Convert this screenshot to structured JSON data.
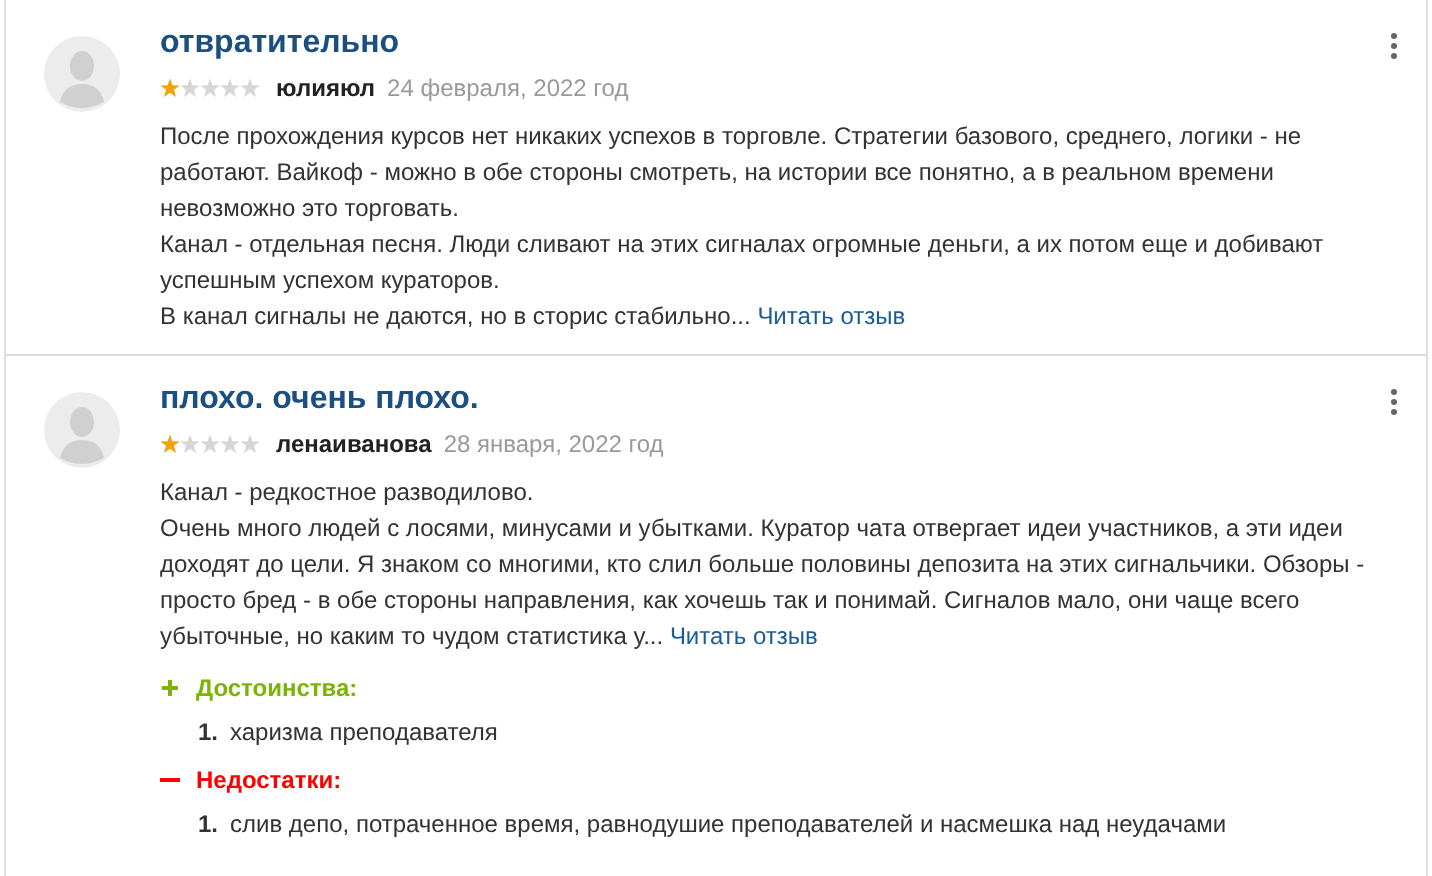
{
  "reviews": [
    {
      "title": "отвратительно",
      "stars": 1,
      "author": "юлияюл",
      "date": "24 февраля, 2022 год",
      "paragraphs": [
        "После прохождения курсов нет никаких успехов в торговле. Стратегии базового, среднего, логики - не работают. Вайкоф - можно в обе стороны смотреть, на истории все понятно, а в реальном времени невозможно это торговать.",
        "Канал - отдельная песня. Люди сливают на этих сигналах огромные деньги, а их потом еще и добивают успешным успехом кураторов.",
        "В канал сигналы не даются, но в сторис стабильно..."
      ],
      "read_more": "Читать отзыв"
    },
    {
      "title": "плохо. очень плохо.",
      "stars": 1,
      "author": "ленаиванова",
      "date": "28 января, 2022 год",
      "paragraphs": [
        "Канал - редкостное разводилово.",
        "Очень много людей с лосями, минусами и убытками. Куратор чата отвергает идеи участников, а эти идеи доходят до цели. Я знаком со многими, кто слил больше половины депозита на этих сигнальчики. Обзоры - просто бред - в обе стороны направления, как хочешь так и понимай. Сигналов мало, они чаще всего убыточные, но каким то чудом статистика у..."
      ],
      "read_more": "Читать отзыв",
      "sections": [
        {
          "kind": "pros",
          "heading": "Достоинства:",
          "items": [
            {
              "number": "1.",
              "text": "харизма преподавателя"
            }
          ]
        },
        {
          "kind": "cons",
          "heading": "Недостатки:",
          "items": [
            {
              "number": "1.",
              "text": "слив депо, потраченное время, равнодушие преподавателей и насмешка над неудачами"
            }
          ]
        }
      ]
    }
  ]
}
